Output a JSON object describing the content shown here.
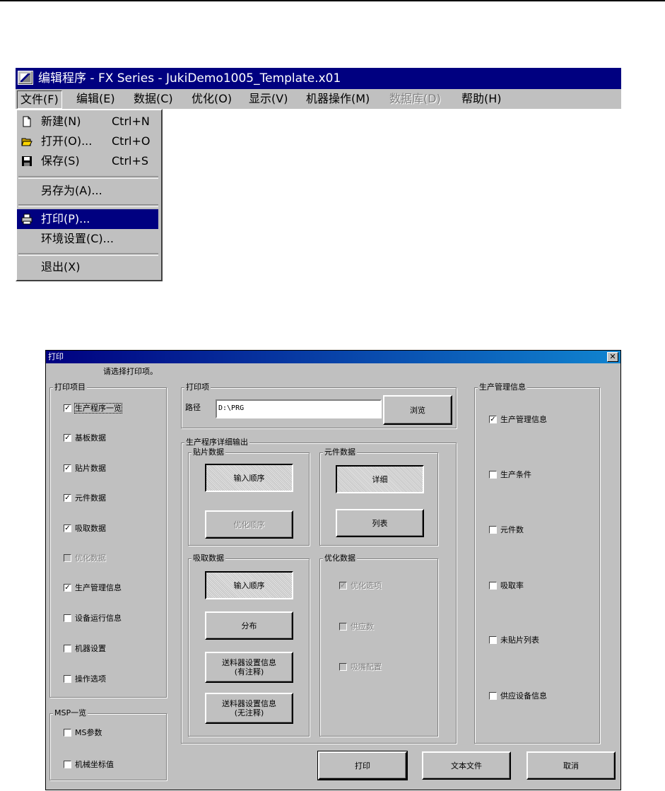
{
  "window": {
    "title": "编辑程序 - FX Series - JukiDemo1005_Template.x01",
    "menus": [
      {
        "label": "文件(F)"
      },
      {
        "label": "编辑(E)"
      },
      {
        "label": "数据(C)"
      },
      {
        "label": "优化(O)"
      },
      {
        "label": "显示(V)"
      },
      {
        "label": "机器操作(M)"
      },
      {
        "label": "数据库(D)",
        "disabled": true
      },
      {
        "label": "帮助(H)"
      }
    ],
    "file_menu": {
      "new": {
        "label": "新建(N)",
        "shortcut": "Ctrl+N",
        "icon": "new-file-icon"
      },
      "open": {
        "label": "打开(O)...",
        "shortcut": "Ctrl+O",
        "icon": "open-folder-icon"
      },
      "save": {
        "label": "保存(S)",
        "shortcut": "Ctrl+S",
        "icon": "floppy-disk-icon"
      },
      "save_as": {
        "label": "另存为(A)..."
      },
      "print": {
        "label": "打印(P)...",
        "icon": "printer-icon",
        "highlighted": true
      },
      "settings": {
        "label": "环境设置(C)..."
      },
      "exit": {
        "label": "退出(X)"
      }
    }
  },
  "dialog": {
    "title": "打印",
    "close": "✕",
    "hint": "请选择打印项。",
    "print_items": {
      "title": "打印项目",
      "items": [
        {
          "label": "生产程序一览",
          "checked": true
        },
        {
          "label": "基板数据",
          "checked": true
        },
        {
          "label": "贴片数据",
          "checked": true
        },
        {
          "label": "元件数据",
          "checked": true
        },
        {
          "label": "吸取数据",
          "checked": true
        },
        {
          "label": "优化数据",
          "checked": false,
          "disabled": true
        },
        {
          "label": "生产管理信息",
          "checked": true
        },
        {
          "label": "设备运行信息",
          "checked": false
        },
        {
          "label": "机器设置",
          "checked": false
        },
        {
          "label": "操作选项",
          "checked": false
        }
      ]
    },
    "msp": {
      "title": "MSP一览",
      "items": [
        {
          "label": "MS参数",
          "checked": false
        },
        {
          "label": "机械坐标值",
          "checked": false
        }
      ]
    },
    "print_options": {
      "title": "打印项",
      "path_label": "路径",
      "path_value": "D:\\PRG",
      "browse": "浏览"
    },
    "detail": {
      "title": "生产程序详细输出",
      "placement": {
        "title": "贴片数据",
        "input_order": "输入顺序",
        "opt_order": "优化顺序"
      },
      "component": {
        "title": "元件数据",
        "detail": "详细",
        "list": "列表"
      },
      "pickup": {
        "title": "吸取数据",
        "input_order": "输入顺序",
        "distribution": "分布",
        "feeder_with": "送料器设置信息\n(有注释)",
        "feeder_without": "送料器设置信息\n(无注释)"
      },
      "optimize": {
        "title": "优化数据",
        "items": [
          {
            "label": "优化选项",
            "checked": true,
            "disabled": true
          },
          {
            "label": "供应数",
            "checked": false,
            "disabled": true
          },
          {
            "label": "吸嘴配置",
            "checked": false,
            "disabled": true
          }
        ]
      }
    },
    "production": {
      "title": "生产管理信息",
      "items": [
        {
          "label": "生产管理信息",
          "checked": true
        },
        {
          "label": "生产条件",
          "checked": false
        },
        {
          "label": "元件数",
          "checked": false
        },
        {
          "label": "吸取率",
          "checked": false
        },
        {
          "label": "未贴片列表",
          "checked": false
        },
        {
          "label": "供应设备信息",
          "checked": false
        }
      ]
    },
    "buttons": {
      "print": "打印",
      "text_file": "文本文件",
      "cancel": "取消"
    }
  }
}
